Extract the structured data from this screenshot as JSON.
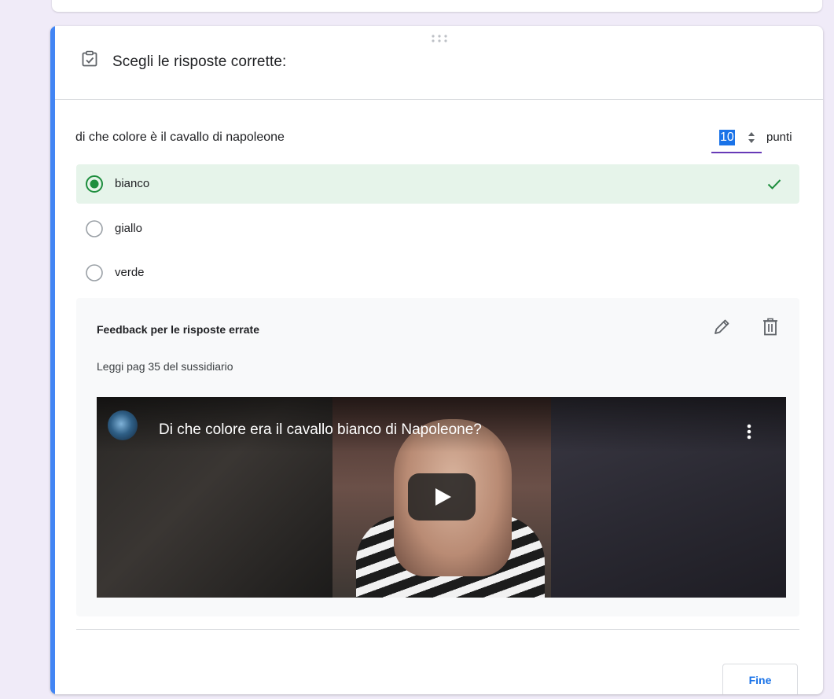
{
  "section": {
    "title": "Scegli le risposte corrette:",
    "icon": "checkbox-checked-icon"
  },
  "question": {
    "text": "di che colore è il cavallo di napoleone",
    "points_value": "10",
    "points_label": "punti"
  },
  "options": [
    {
      "label": "bianco",
      "selected": true,
      "correct": true
    },
    {
      "label": "giallo",
      "selected": false,
      "correct": false
    },
    {
      "label": "verde",
      "selected": false,
      "correct": false
    }
  ],
  "feedback": {
    "title": "Feedback per le risposte errate",
    "text": "Leggi pag 35 del sussidiario",
    "video_title": "Di che colore era il cavallo bianco di Napoleone?"
  },
  "done_label": "Fine",
  "colors": {
    "accent": "#4285f4",
    "correct_bg": "#e6f4ea",
    "correct_icon": "#1e8e3e",
    "primary_text_button": "#1a73e8",
    "underline": "#673ab7"
  }
}
